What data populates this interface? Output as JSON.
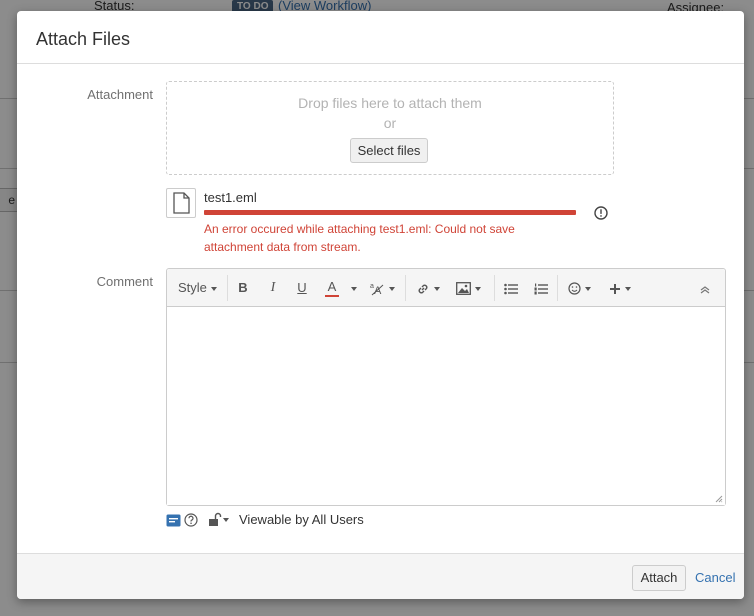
{
  "background": {
    "status_label": "Status:",
    "status_lozenge": "TO DO",
    "view_workflow": "(View Workflow)",
    "assignee_label": "Assignee:",
    "side_button": "e"
  },
  "dialog": {
    "title": "Attach Files",
    "attachment_label": "Attachment",
    "drop_text": "Drop files here to attach them",
    "drop_or": "or",
    "select_files": "Select files",
    "file": {
      "name": "test1.eml",
      "error": "An error occured while attaching test1.eml: Could not save attachment data from stream."
    },
    "comment_label": "Comment",
    "toolbar": {
      "style": "Style"
    },
    "visibility": "Viewable by All Users",
    "attach_button": "Attach",
    "cancel_link": "Cancel"
  },
  "colors": {
    "error": "#d04437",
    "link": "#3572b0",
    "lozenge": "#4a6785"
  },
  "icons": [
    "file-icon",
    "error-icon",
    "bold-icon",
    "italic-icon",
    "underline-icon",
    "text-color-icon",
    "text-format-icon",
    "link-icon",
    "image-icon",
    "bullet-list-icon",
    "numbered-list-icon",
    "emoticon-icon",
    "insert-more-icon",
    "collapse-toolbar-icon",
    "text-mode-icon",
    "help-icon",
    "lock-icon",
    "resize-grip-icon"
  ]
}
